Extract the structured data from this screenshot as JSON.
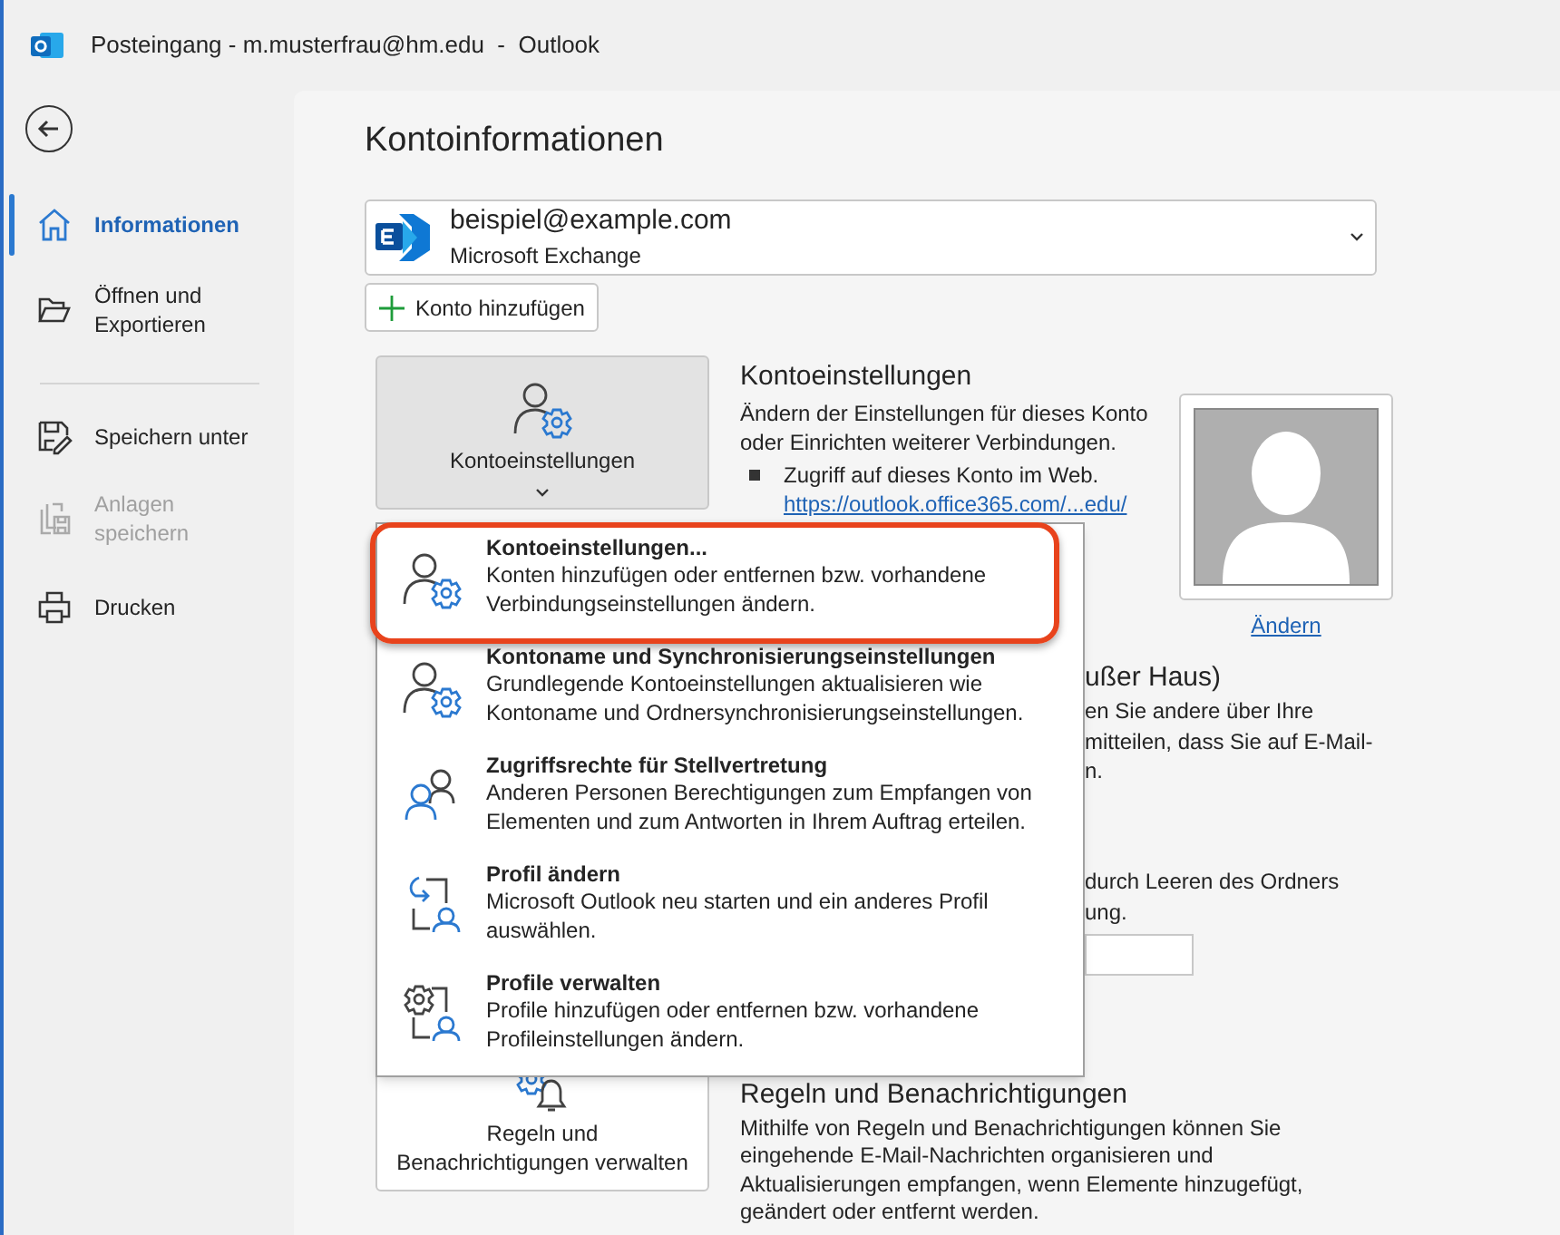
{
  "window": {
    "title": "Posteingang - m.musterfrau@hm.edu  -  Outlook"
  },
  "sidebar": {
    "items": [
      {
        "label": "Informationen",
        "kind": "home",
        "selected": true,
        "disabled": false
      },
      {
        "label": "Öffnen und\nExportieren",
        "kind": "folder",
        "selected": false,
        "disabled": false
      },
      {
        "label": "Speichern unter",
        "kind": "save",
        "selected": false,
        "disabled": false
      },
      {
        "label": "Anlagen\nspeichern",
        "kind": "attachments",
        "selected": false,
        "disabled": true
      },
      {
        "label": "Drucken",
        "kind": "print",
        "selected": false,
        "disabled": false
      }
    ]
  },
  "page_title": "Kontoinformationen",
  "account": {
    "email": "beispiel@example.com",
    "type": "Microsoft Exchange"
  },
  "add_account_button": "Konto hinzufügen",
  "account_settings": {
    "button": "Kontoeinstellungen",
    "pressed": true,
    "heading": "Kontoeinstellungen",
    "description": "Ändern der Einstellungen für dieses Konto\noder Einrichten weiterer Verbindungen.",
    "bullet": "Zugriff auf dieses Konto im Web.",
    "link": "https://outlook.office365.com/...edu/",
    "photo_link": "Ändern"
  },
  "out_of_office": {
    "heading": "ußer Haus)",
    "lines": [
      "en Sie andere über Ihre",
      "mitteilen, dass Sie auf E-Mail-",
      "n."
    ]
  },
  "cleanup": {
    "lines": [
      "durch Leeren des Ordners",
      "ung."
    ]
  },
  "rules": {
    "button": "Regeln und\nBenachrichtigungen verwalten",
    "heading": "Regeln und Benachrichtigungen",
    "description": "Mithilfe von Regeln und Benachrichtigungen können Sie\neingehende E-Mail-Nachrichten organisieren und\nAktualisierungen empfangen, wenn Elemente hinzugefügt,\ngeändert oder entfernt werden."
  },
  "menu": {
    "items": [
      {
        "kind": "account-gear",
        "title": "Kontoeinstellungen...",
        "description": "Konten hinzufügen oder entfernen bzw. vorhandene\nVerbindungseinstellungen ändern.",
        "highlighted": true
      },
      {
        "kind": "account-gear",
        "title": "Kontoname und Synchronisierungseinstellungen",
        "description": "Grundlegende Kontoeinstellungen aktualisieren wie\nKontoname und Ordnersynchronisierungseinstellungen.",
        "highlighted": false
      },
      {
        "kind": "delegate",
        "title": "Zugriffsrechte für Stellvertretung",
        "description": "Anderen Personen Berechtigungen zum Empfangen von\nElementen und zum Antworten in Ihrem Auftrag erteilen.",
        "highlighted": false
      },
      {
        "kind": "switch-profile",
        "title": "Profil ändern",
        "description": "Microsoft Outlook neu starten und ein anderes Profil\nauswählen.",
        "highlighted": false
      },
      {
        "kind": "manage-profiles",
        "title": "Profile verwalten",
        "description": "Profile hinzufügen oder entfernen bzw. vorhandene\nProfileinstellungen ändern.",
        "highlighted": false
      }
    ]
  }
}
